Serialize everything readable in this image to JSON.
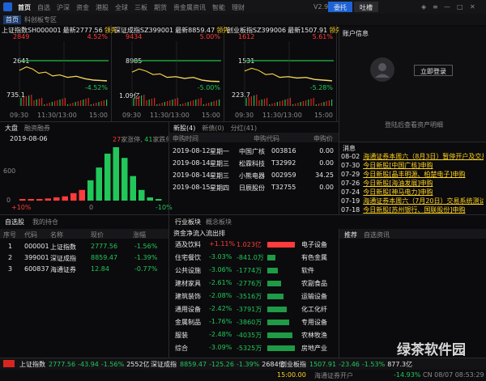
{
  "topbar": {
    "tabs": [
      "首页",
      "自选",
      "沪深",
      "资金",
      "港股",
      "全球",
      "三板",
      "期货",
      "贵金属",
      "资讯",
      "智能",
      "理财"
    ],
    "version": "V2.9.0",
    "trade_btn": "委托",
    "comment_btn": "吐槽",
    "btn_colors": {
      "trade": "#1e63d6",
      "comment": "#2a2a2e"
    }
  },
  "subtabs": [
    "首页",
    "科创板专区"
  ],
  "indices": [
    {
      "label": "上证指数",
      "code": "SH000001",
      "price": "最新2777.56",
      "lead": "领先",
      "top": "2849",
      "top_pct": "4.52%",
      "mid": "2641",
      "bot_pct": "-4.52%",
      "vol": "735.1",
      "times": [
        "09:30",
        "11:30/13:00",
        "15:00"
      ]
    },
    {
      "label": "深证成指",
      "code": "SZ399001",
      "price": "最新8859.47",
      "lead": "领先",
      "top": "9434",
      "top_pct": "5.00%",
      "mid": "8985",
      "bot_pct": "-5.00%",
      "vol": "1.09亿",
      "times": [
        "09:30",
        "11:30/13:00",
        "15:00"
      ]
    },
    {
      "label": "创业板指",
      "code": "SZ399006",
      "price": "最新1507.91",
      "lead": "领先",
      "top": "1612",
      "top_pct": "5.61%",
      "mid": "1531",
      "bot_pct": "-5.28%",
      "vol": "223.7",
      "times": [
        "09:30",
        "11:30/13:00",
        "15:00"
      ]
    }
  ],
  "account": {
    "title": "账户信息",
    "login": "立即登录",
    "hint": "登陆后查看资产明细"
  },
  "market_panel": {
    "tab1": "大盘",
    "tab2": "融资融券",
    "date": "2019-08-06",
    "up_count": "27",
    "up_label": "家涨停,",
    "down_count": "41",
    "down_label": "家跌停",
    "y_top": "600",
    "y_bot": "0",
    "x_left": "+10%",
    "x_mid": "0",
    "x_right": "-10%",
    "bars_red": [
      0.02,
      0.03,
      0.03,
      0.04,
      0.06,
      0.08,
      0.14,
      0.2
    ],
    "bars_green": [
      0.38,
      0.62,
      0.88,
      1.0,
      0.8,
      0.46,
      0.2,
      0.06,
      0.03
    ]
  },
  "ipo": {
    "tabs": [
      "新股(4)",
      "新债(0)",
      "分红(41)"
    ],
    "headers": [
      "申购时间",
      "申购代码",
      "申购价"
    ],
    "rows": [
      {
        "date": "2019-08-12",
        "day": "星期一",
        "name": "中国广核",
        "code": "003816",
        "price": "0.00"
      },
      {
        "date": "2019-08-14",
        "day": "星期三",
        "name": "松霖科技",
        "code": "T32992",
        "price": "0.00"
      },
      {
        "date": "2019-08-14",
        "day": "星期三",
        "name": "小熊电器",
        "code": "002959",
        "price": "34.25"
      },
      {
        "date": "2019-08-15",
        "day": "星期四",
        "name": "日辰股份",
        "code": "T32755",
        "price": "0.00"
      }
    ]
  },
  "news": {
    "title": "消息",
    "items": [
      {
        "date": "08-02",
        "text": "海通证券本周六（8月3日）暂停开户及交易..."
      },
      {
        "date": "07-30",
        "text": "今日新股[中国广核]申购"
      },
      {
        "date": "07-29",
        "text": "今日新股[晶丰明源、柏楚电子]申购"
      },
      {
        "date": "07-26",
        "text": "今日新股[海油发展]申购"
      },
      {
        "date": "07-24",
        "text": "今日新股[神马电力]申购"
      },
      {
        "date": "07-19",
        "text": "海通证券本周六（7月20日）交易系统测试公告"
      },
      {
        "date": "07-18",
        "text": "今日新股[苏州银行、国联股份]申购"
      }
    ]
  },
  "watch": {
    "tabs": [
      "自选股",
      "我的持仓"
    ],
    "headers": [
      "序号",
      "代码",
      "名称",
      "现价",
      "涨幅"
    ],
    "rows": [
      {
        "no": "1",
        "code": "000001",
        "name": "上证指数",
        "price": "2777.56",
        "pct": "-1.56%"
      },
      {
        "no": "2",
        "code": "399001",
        "name": "深证成指",
        "price": "8859.47",
        "pct": "-1.39%"
      },
      {
        "no": "3",
        "code": "600837",
        "name": "海通证券",
        "price": "12.84",
        "pct": "-0.77%"
      }
    ]
  },
  "sector": {
    "tabs": [
      "行业板块",
      "概念板块"
    ],
    "subtitle": "资金净流入流出排",
    "rows": [
      {
        "name": "酒及饮料",
        "pct": "+1.11%",
        "flow": "1.023亿",
        "right": "电子设备",
        "up": true
      },
      {
        "name": "住宅餐饮",
        "pct": "-3.03%",
        "flow": "-841.0万",
        "right": "有色金属",
        "up": false
      },
      {
        "name": "公共设施",
        "pct": "-3.06%",
        "flow": "-1774万",
        "right": "软件",
        "up": false
      },
      {
        "name": "建材家具",
        "pct": "-2.61%",
        "flow": "-2776万",
        "right": "农副食品",
        "up": false
      },
      {
        "name": "建筑装饰",
        "pct": "-2.08%",
        "flow": "-3516万",
        "right": "运输设备",
        "up": false
      },
      {
        "name": "通用设备",
        "pct": "-2.42%",
        "flow": "-3791万",
        "right": "化工化纤",
        "up": false
      },
      {
        "name": "金属制品",
        "pct": "-1.76%",
        "flow": "-3860万",
        "right": "专用设备",
        "up": false
      },
      {
        "name": "服装",
        "pct": "-2.48%",
        "flow": "-4035万",
        "right": "农林牧渔",
        "up": false
      },
      {
        "name": "综合",
        "pct": "-3.09%",
        "flow": "-5325万",
        "right": "房地产业",
        "up": false
      }
    ]
  },
  "recommend": {
    "tabs": [
      "推荐",
      "自选资讯"
    ]
  },
  "ticker": [
    {
      "name": "上证指数",
      "price": "2777.56",
      "chg": "-43.94",
      "pct": "-1.56%",
      "amt": "2552亿"
    },
    {
      "name": "深证成指",
      "price": "8859.47",
      "chg": "-125.26",
      "pct": "-1.39%",
      "amt": "2684亿"
    },
    {
      "name": "创业板指",
      "price": "1507.91",
      "chg": "-23.46",
      "pct": "-1.53%",
      "amt": "877.3亿"
    }
  ],
  "statusbar": {
    "time": "15:00.00",
    "label": "海通证券开户",
    "val": "-14.93%",
    "clock": "CN 08/07 08:53:29"
  },
  "watermark": "绿茶软件园"
}
